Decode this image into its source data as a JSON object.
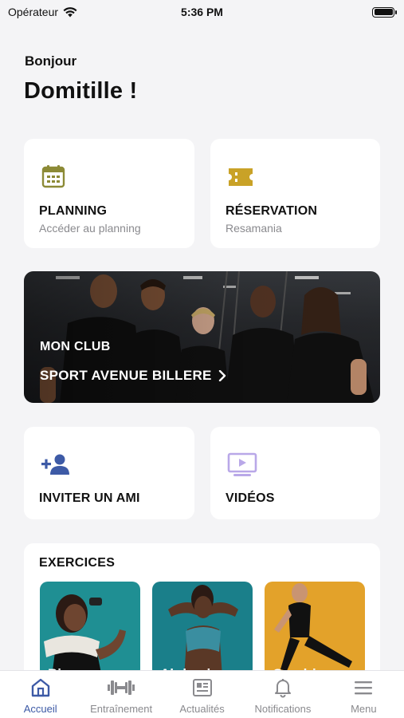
{
  "status_bar": {
    "carrier": "Opérateur",
    "time": "5:36 PM"
  },
  "greeting": "Bonjour",
  "user_name": "Domitille !",
  "shortcuts": {
    "planning": {
      "title": "PLANNING",
      "subtitle": "Accéder au planning",
      "icon": "calendar-icon",
      "color": "#8c8a36"
    },
    "reservation": {
      "title": "RÉSERVATION",
      "subtitle": "Resamania",
      "icon": "ticket-icon",
      "color": "#c9a227"
    },
    "invite": {
      "title": "INVITER UN AMI",
      "icon": "add-user-icon",
      "color": "#3d5aa6"
    },
    "videos": {
      "title": "VIDÉOS",
      "icon": "video-icon",
      "color": "#b9a8e8"
    }
  },
  "club": {
    "label": "MON CLUB",
    "name": "SPORT AVENUE BILLERE"
  },
  "exercises": {
    "title": "EXERCICES",
    "items": [
      {
        "label": "Biceps",
        "color": "#1f8f93"
      },
      {
        "label": "Abdomina",
        "color": "#1a7f8a"
      },
      {
        "label": "Quadricens",
        "color": "#e3a22a"
      }
    ]
  },
  "tabbar": {
    "items": [
      {
        "label": "Accueil",
        "icon": "home-icon",
        "active": true
      },
      {
        "label": "Entraînement",
        "icon": "dumbbell-icon",
        "active": false
      },
      {
        "label": "Actualités",
        "icon": "news-icon",
        "active": false
      },
      {
        "label": "Notifications",
        "icon": "bell-icon",
        "active": false
      },
      {
        "label": "Menu",
        "icon": "menu-icon",
        "active": false
      }
    ]
  },
  "colors": {
    "accent": "#3d5aa6",
    "background": "#f4f4f6"
  }
}
